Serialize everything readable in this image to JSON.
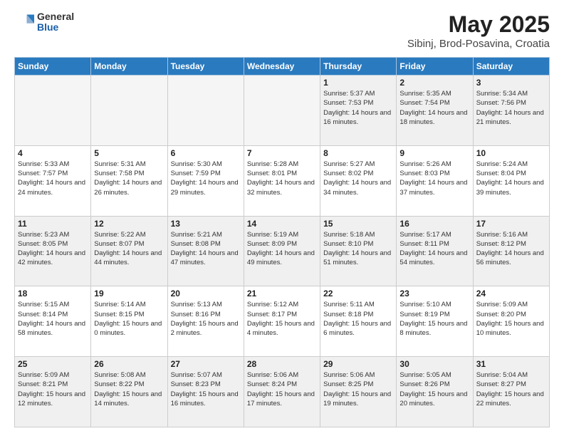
{
  "header": {
    "logo_general": "General",
    "logo_blue": "Blue",
    "month_title": "May 2025",
    "location": "Sibinj, Brod-Posavina, Croatia"
  },
  "weekdays": [
    "Sunday",
    "Monday",
    "Tuesday",
    "Wednesday",
    "Thursday",
    "Friday",
    "Saturday"
  ],
  "weeks": [
    [
      {
        "day": "",
        "empty": true
      },
      {
        "day": "",
        "empty": true
      },
      {
        "day": "",
        "empty": true
      },
      {
        "day": "",
        "empty": true
      },
      {
        "day": "1",
        "sunrise": "5:37 AM",
        "sunset": "7:53 PM",
        "daylight": "14 hours and 16 minutes."
      },
      {
        "day": "2",
        "sunrise": "5:35 AM",
        "sunset": "7:54 PM",
        "daylight": "14 hours and 18 minutes."
      },
      {
        "day": "3",
        "sunrise": "5:34 AM",
        "sunset": "7:56 PM",
        "daylight": "14 hours and 21 minutes."
      }
    ],
    [
      {
        "day": "4",
        "sunrise": "5:33 AM",
        "sunset": "7:57 PM",
        "daylight": "14 hours and 24 minutes."
      },
      {
        "day": "5",
        "sunrise": "5:31 AM",
        "sunset": "7:58 PM",
        "daylight": "14 hours and 26 minutes."
      },
      {
        "day": "6",
        "sunrise": "5:30 AM",
        "sunset": "7:59 PM",
        "daylight": "14 hours and 29 minutes."
      },
      {
        "day": "7",
        "sunrise": "5:28 AM",
        "sunset": "8:01 PM",
        "daylight": "14 hours and 32 minutes."
      },
      {
        "day": "8",
        "sunrise": "5:27 AM",
        "sunset": "8:02 PM",
        "daylight": "14 hours and 34 minutes."
      },
      {
        "day": "9",
        "sunrise": "5:26 AM",
        "sunset": "8:03 PM",
        "daylight": "14 hours and 37 minutes."
      },
      {
        "day": "10",
        "sunrise": "5:24 AM",
        "sunset": "8:04 PM",
        "daylight": "14 hours and 39 minutes."
      }
    ],
    [
      {
        "day": "11",
        "sunrise": "5:23 AM",
        "sunset": "8:05 PM",
        "daylight": "14 hours and 42 minutes."
      },
      {
        "day": "12",
        "sunrise": "5:22 AM",
        "sunset": "8:07 PM",
        "daylight": "14 hours and 44 minutes."
      },
      {
        "day": "13",
        "sunrise": "5:21 AM",
        "sunset": "8:08 PM",
        "daylight": "14 hours and 47 minutes."
      },
      {
        "day": "14",
        "sunrise": "5:19 AM",
        "sunset": "8:09 PM",
        "daylight": "14 hours and 49 minutes."
      },
      {
        "day": "15",
        "sunrise": "5:18 AM",
        "sunset": "8:10 PM",
        "daylight": "14 hours and 51 minutes."
      },
      {
        "day": "16",
        "sunrise": "5:17 AM",
        "sunset": "8:11 PM",
        "daylight": "14 hours and 54 minutes."
      },
      {
        "day": "17",
        "sunrise": "5:16 AM",
        "sunset": "8:12 PM",
        "daylight": "14 hours and 56 minutes."
      }
    ],
    [
      {
        "day": "18",
        "sunrise": "5:15 AM",
        "sunset": "8:14 PM",
        "daylight": "14 hours and 58 minutes."
      },
      {
        "day": "19",
        "sunrise": "5:14 AM",
        "sunset": "8:15 PM",
        "daylight": "15 hours and 0 minutes."
      },
      {
        "day": "20",
        "sunrise": "5:13 AM",
        "sunset": "8:16 PM",
        "daylight": "15 hours and 2 minutes."
      },
      {
        "day": "21",
        "sunrise": "5:12 AM",
        "sunset": "8:17 PM",
        "daylight": "15 hours and 4 minutes."
      },
      {
        "day": "22",
        "sunrise": "5:11 AM",
        "sunset": "8:18 PM",
        "daylight": "15 hours and 6 minutes."
      },
      {
        "day": "23",
        "sunrise": "5:10 AM",
        "sunset": "8:19 PM",
        "daylight": "15 hours and 8 minutes."
      },
      {
        "day": "24",
        "sunrise": "5:09 AM",
        "sunset": "8:20 PM",
        "daylight": "15 hours and 10 minutes."
      }
    ],
    [
      {
        "day": "25",
        "sunrise": "5:09 AM",
        "sunset": "8:21 PM",
        "daylight": "15 hours and 12 minutes."
      },
      {
        "day": "26",
        "sunrise": "5:08 AM",
        "sunset": "8:22 PM",
        "daylight": "15 hours and 14 minutes."
      },
      {
        "day": "27",
        "sunrise": "5:07 AM",
        "sunset": "8:23 PM",
        "daylight": "15 hours and 16 minutes."
      },
      {
        "day": "28",
        "sunrise": "5:06 AM",
        "sunset": "8:24 PM",
        "daylight": "15 hours and 17 minutes."
      },
      {
        "day": "29",
        "sunrise": "5:06 AM",
        "sunset": "8:25 PM",
        "daylight": "15 hours and 19 minutes."
      },
      {
        "day": "30",
        "sunrise": "5:05 AM",
        "sunset": "8:26 PM",
        "daylight": "15 hours and 20 minutes."
      },
      {
        "day": "31",
        "sunrise": "5:04 AM",
        "sunset": "8:27 PM",
        "daylight": "15 hours and 22 minutes."
      }
    ]
  ]
}
